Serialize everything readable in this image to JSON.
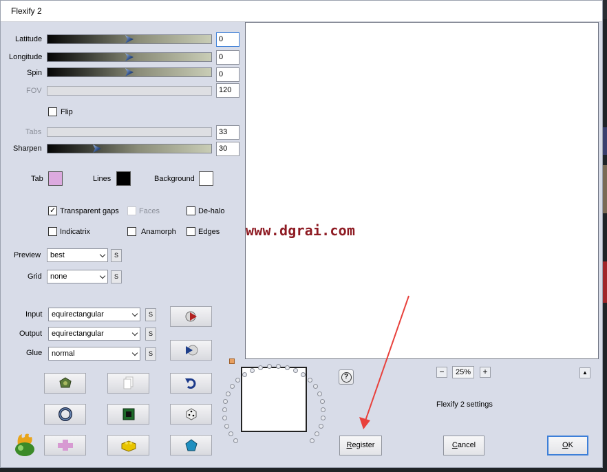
{
  "window": {
    "title": "Flexify 2"
  },
  "sliders": [
    {
      "label": "Latitude",
      "value": "0",
      "position": 0.5,
      "enabled": true
    },
    {
      "label": "Longitude",
      "value": "0",
      "position": 0.5,
      "enabled": true
    },
    {
      "label": "Spin",
      "value": "0",
      "position": 0.5,
      "enabled": true
    },
    {
      "label": "FOV",
      "value": "120",
      "enabled": false
    },
    {
      "label": "Tabs",
      "value": "33",
      "enabled": false
    },
    {
      "label": "Sharpen",
      "value": "30",
      "position": 0.3,
      "enabled": true
    }
  ],
  "flip": {
    "label": "Flip",
    "checked": false
  },
  "colors": {
    "tab": {
      "label": "Tab",
      "color": "#dcaadf"
    },
    "lines": {
      "label": "Lines",
      "color": "#000000"
    },
    "background": {
      "label": "Background",
      "color": "#ffffff"
    }
  },
  "options": {
    "transparent_gaps": {
      "label": "Transparent gaps",
      "checked": true
    },
    "faces": {
      "label": "Faces",
      "checked": false,
      "enabled": false
    },
    "de_halo": {
      "label": "De-halo",
      "checked": false
    },
    "indicatrix": {
      "label": "Indicatrix",
      "checked": false
    },
    "anamorph": {
      "label": "Anamorph",
      "checked": false
    },
    "edges": {
      "label": "Edges",
      "checked": false
    }
  },
  "preview_select": {
    "label": "Preview",
    "value": "best"
  },
  "grid_select": {
    "label": "Grid",
    "value": "none"
  },
  "input_select": {
    "label": "Input",
    "value": "equirectangular"
  },
  "output_select": {
    "label": "Output",
    "value": "equirectangular"
  },
  "glue_select": {
    "label": "Glue",
    "value": "normal"
  },
  "s_label": "S",
  "watermark": "www.dgrai.com",
  "zoom": {
    "minus": "−",
    "value": "25%",
    "plus": "+"
  },
  "settings_label": "Flexify 2 settings",
  "help_label": "?",
  "collapse_label": "▲",
  "buttons": {
    "register": {
      "accesskey": "R",
      "rest": "egister"
    },
    "cancel": {
      "accesskey": "C",
      "rest": "ancel"
    },
    "ok": {
      "accesskey": "O",
      "rest": "K"
    }
  },
  "accent_colors": {
    "arrow": "#e8413c",
    "watermark": "#8e1b23"
  }
}
